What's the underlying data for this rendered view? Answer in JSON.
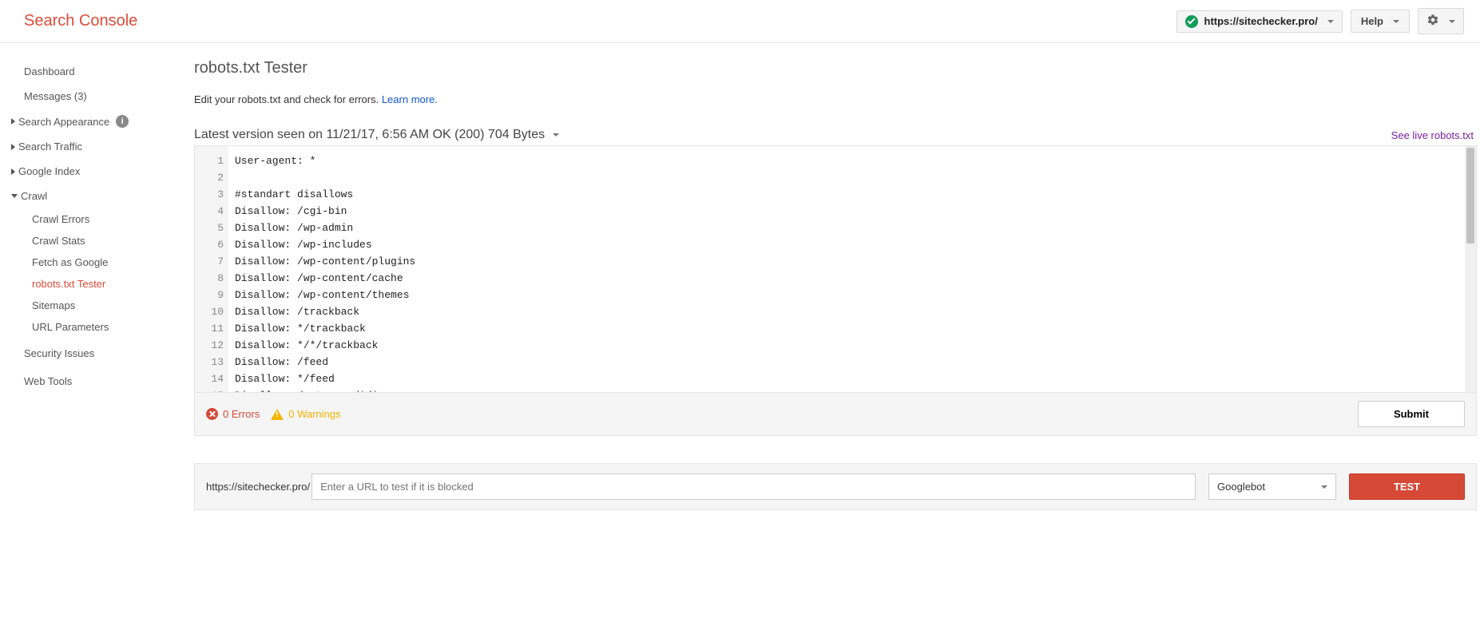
{
  "header": {
    "brand": "Search Console",
    "property": "https://sitechecker.pro/",
    "help_label": "Help"
  },
  "sidebar": {
    "dashboard": "Dashboard",
    "messages": "Messages (3)",
    "search_appearance": "Search Appearance",
    "search_traffic": "Search Traffic",
    "google_index": "Google Index",
    "crawl": "Crawl",
    "crawl_children": {
      "crawl_errors": "Crawl Errors",
      "crawl_stats": "Crawl Stats",
      "fetch_as_google": "Fetch as Google",
      "robots_tester": "robots.txt Tester",
      "sitemaps": "Sitemaps",
      "url_parameters": "URL Parameters"
    },
    "security_issues": "Security Issues",
    "web_tools": "Web Tools"
  },
  "main": {
    "title": "robots.txt Tester",
    "desc_text": "Edit your robots.txt and check for errors. ",
    "learn_more": "Learn more.",
    "version_line": "Latest version seen on 11/21/17, 6:56 AM OK (200) 704 Bytes",
    "live_link": "See live robots.txt",
    "code_lines": [
      "User-agent: *",
      "",
      "#standart disallows",
      "Disallow: /cgi-bin",
      "Disallow: /wp-admin",
      "Disallow: /wp-includes",
      "Disallow: /wp-content/plugins",
      "Disallow: /wp-content/cache",
      "Disallow: /wp-content/themes",
      "Disallow: /trackback",
      "Disallow: */trackback",
      "Disallow: */*/trackback",
      "Disallow: /feed",
      "Disallow: */feed",
      "Disallow: /category/*/*"
    ],
    "errors_text": "0 Errors",
    "warnings_text": "0 Warnings",
    "submit_label": "Submit",
    "url_prefix": "https://sitechecker.pro/",
    "url_placeholder": "Enter a URL to test if it is blocked",
    "bot": "Googlebot",
    "test_label": "TEST"
  }
}
